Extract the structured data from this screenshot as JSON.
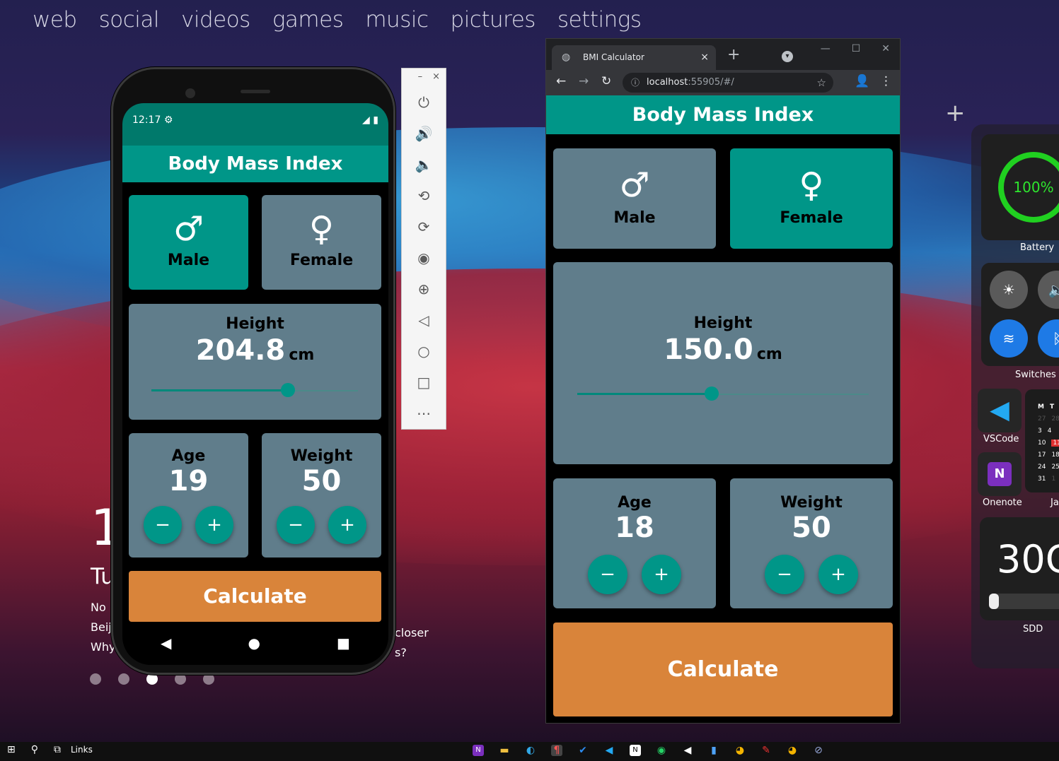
{
  "topnav": [
    "web",
    "social",
    "videos",
    "games",
    "music",
    "pictures",
    "settings"
  ],
  "news": {
    "big": "1",
    "mid": "Tu",
    "lines": [
      "No",
      "Beij",
      "Why"
    ],
    "right_lines": [
      "closer",
      "s?"
    ]
  },
  "phone": {
    "time": "12:17",
    "status_icons": [
      "gear-icon",
      "signal-icon",
      "battery-icon"
    ],
    "app_title": "Body Mass Index",
    "male_label": "Male",
    "female_label": "Female",
    "male_selected": true,
    "height_title": "Height",
    "height_value": "204.8",
    "height_unit": "cm",
    "height_slider_fraction": 0.66,
    "age_title": "Age",
    "age_value": "19",
    "weight_title": "Weight",
    "weight_value": "50",
    "minus": "−",
    "plus": "+",
    "calculate": "Calculate"
  },
  "emulator_toolbar": {
    "minimize": "–",
    "close": "×",
    "tools": [
      "power-icon",
      "volume-up-icon",
      "volume-down-icon",
      "rotate-left-icon",
      "rotate-right-icon",
      "camera-icon",
      "zoom-icon",
      "back-icon",
      "home-icon",
      "overview-icon",
      "more-icon"
    ]
  },
  "browser": {
    "tab_title": "BMI Calculator",
    "tab_close": "×",
    "new_tab": "+",
    "address_host": "localhost",
    "address_rest": ":55905/#/",
    "app_title": "Body Mass Index",
    "male_label": "Male",
    "female_label": "Female",
    "female_selected": true,
    "height_title": "Height",
    "height_value": "150.0",
    "height_unit": "cm",
    "height_slider_fraction": 0.46,
    "age_title": "Age",
    "age_value": "18",
    "weight_title": "Weight",
    "weight_value": "50",
    "minus": "−",
    "plus": "+",
    "calculate": "Calculate"
  },
  "widgets": {
    "add": "+",
    "battery_percent": "100%",
    "battery_label": "Battery",
    "switches_label": "Switches",
    "vscode_label": "VSCode",
    "onenote_label": "Onenote",
    "calendar_label": "Ja",
    "calendar_header": [
      "M",
      "T"
    ],
    "calendar_rows": [
      [
        "27",
        "28"
      ],
      [
        "3",
        "4"
      ],
      [
        "10",
        "11"
      ],
      [
        "17",
        "18"
      ],
      [
        "24",
        "25"
      ],
      [
        "31",
        "1"
      ]
    ],
    "storage_value": "30G",
    "storage_label": "SDD",
    "storage_fraction": 0.1
  },
  "taskbar": {
    "links_label": "Links"
  },
  "colors": {
    "teal": "#009688",
    "slate": "#607d8b",
    "orange": "#d9843a",
    "battery_green": "#20d020"
  }
}
